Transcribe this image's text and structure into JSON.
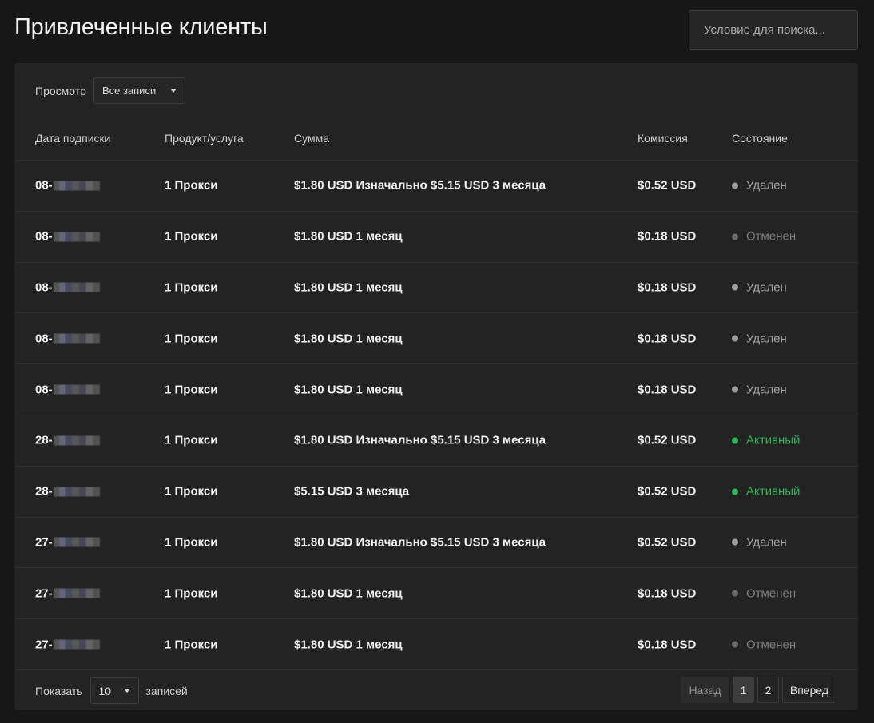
{
  "header": {
    "title": "Привлеченные клиенты",
    "search_placeholder": "Условие для поиска..."
  },
  "view": {
    "label": "Просмотр",
    "selected": "Все записи"
  },
  "table": {
    "columns": [
      "Дата подписки",
      "Продукт/услуга",
      "Сумма",
      "Комиссия",
      "Состояние"
    ],
    "rows": [
      {
        "date": "08-",
        "product": "1 Прокси",
        "amount": "$1.80 USD Изначально $5.15 USD 3 месяца",
        "commission": "$0.52 USD",
        "status": "Удален",
        "status_kind": "deleted"
      },
      {
        "date": "08-",
        "product": "1 Прокси",
        "amount": "$1.80 USD 1 месяц",
        "commission": "$0.18 USD",
        "status": "Отменен",
        "status_kind": "cancelled"
      },
      {
        "date": "08-",
        "product": "1 Прокси",
        "amount": "$1.80 USD 1 месяц",
        "commission": "$0.18 USD",
        "status": "Удален",
        "status_kind": "deleted"
      },
      {
        "date": "08-",
        "product": "1 Прокси",
        "amount": "$1.80 USD 1 месяц",
        "commission": "$0.18 USD",
        "status": "Удален",
        "status_kind": "deleted"
      },
      {
        "date": "08-",
        "product": "1 Прокси",
        "amount": "$1.80 USD 1 месяц",
        "commission": "$0.18 USD",
        "status": "Удален",
        "status_kind": "deleted"
      },
      {
        "date": "28-",
        "product": "1 Прокси",
        "amount": "$1.80 USD Изначально $5.15 USD 3 месяца",
        "commission": "$0.52 USD",
        "status": "Активный",
        "status_kind": "active"
      },
      {
        "date": "28-",
        "product": "1 Прокси",
        "amount": "$5.15 USD 3 месяца",
        "commission": "$0.52 USD",
        "status": "Активный",
        "status_kind": "active"
      },
      {
        "date": "27-",
        "product": "1 Прокси",
        "amount": "$1.80 USD Изначально $5.15 USD 3 месяца",
        "commission": "$0.52 USD",
        "status": "Удален",
        "status_kind": "deleted"
      },
      {
        "date": "27-",
        "product": "1 Прокси",
        "amount": "$1.80 USD 1 месяц",
        "commission": "$0.18 USD",
        "status": "Отменен",
        "status_kind": "cancelled"
      },
      {
        "date": "27-",
        "product": "1 Прокси",
        "amount": "$1.80 USD 1 месяц",
        "commission": "$0.18 USD",
        "status": "Отменен",
        "status_kind": "cancelled"
      }
    ]
  },
  "footer": {
    "show_label": "Показать",
    "page_size": "10",
    "records_label": "записей",
    "pagination": {
      "prev": "Назад",
      "pages": [
        "1",
        "2"
      ],
      "current": "1",
      "next": "Вперед"
    }
  },
  "colors": {
    "active": "#32b557",
    "deleted": "#9c9c9c",
    "cancelled": "#6a6a6a",
    "background": "#171717",
    "panel": "#232323"
  },
  "icons": {
    "dropdown": "chevron-down-icon",
    "status": "status-dot-icon",
    "redaction": "pixelated-date-redaction"
  }
}
